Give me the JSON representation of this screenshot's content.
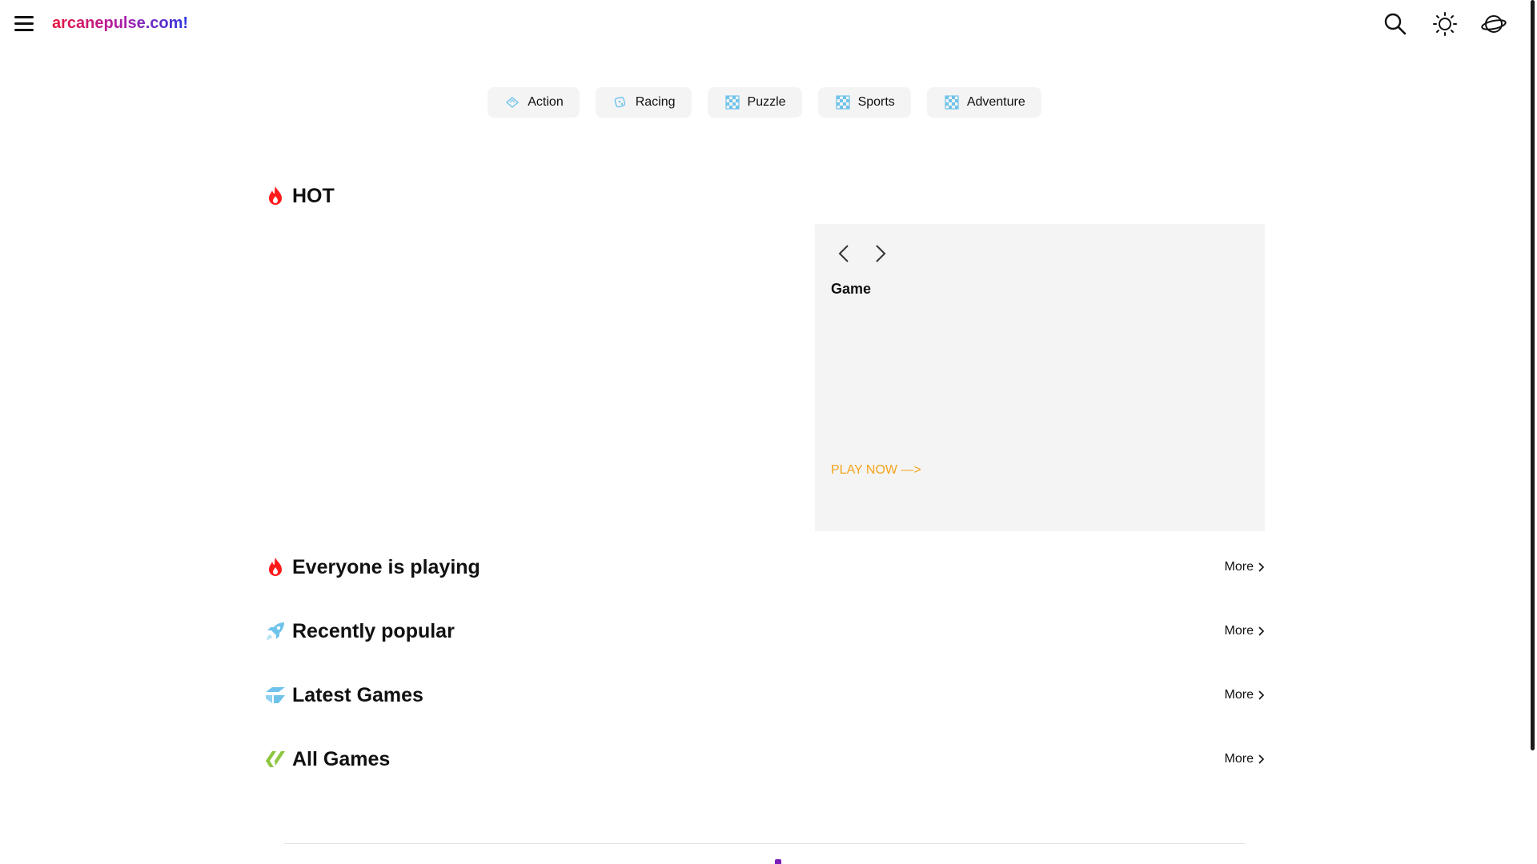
{
  "header": {
    "logo_text": "arcanepulse.com!",
    "icons": [
      "menu-icon",
      "search-icon",
      "sun-icon",
      "planet-icon"
    ]
  },
  "categories": [
    {
      "label": "Action",
      "icon": "action-icon"
    },
    {
      "label": "Racing",
      "icon": "racing-icon"
    },
    {
      "label": "Puzzle",
      "icon": "puzzle-icon"
    },
    {
      "label": "Sports",
      "icon": "sports-icon"
    },
    {
      "label": "Adventure",
      "icon": "adventure-icon"
    }
  ],
  "hot": {
    "title": "HOT",
    "icon": "fire-icon",
    "card": {
      "game_title": "Game",
      "play_label": "PLAY NOW —>"
    }
  },
  "sections": [
    {
      "title": "Everyone is playing",
      "icon": "fire-icon",
      "more_label": "More"
    },
    {
      "title": "Recently popular",
      "icon": "rocket-icon",
      "more_label": "More"
    },
    {
      "title": "Latest Games",
      "icon": "latest-icon",
      "more_label": "More"
    },
    {
      "title": "All Games",
      "icon": "all-games-icon",
      "more_label": "More"
    }
  ],
  "colors": {
    "fire": "#ff1a1a",
    "accent_blue": "#6fc3ea",
    "accent_green": "#8dc63f",
    "play_now": "#f5a31a",
    "logo_gradient": [
      "#e8163b",
      "#b01ea6",
      "#2a36e0"
    ]
  }
}
